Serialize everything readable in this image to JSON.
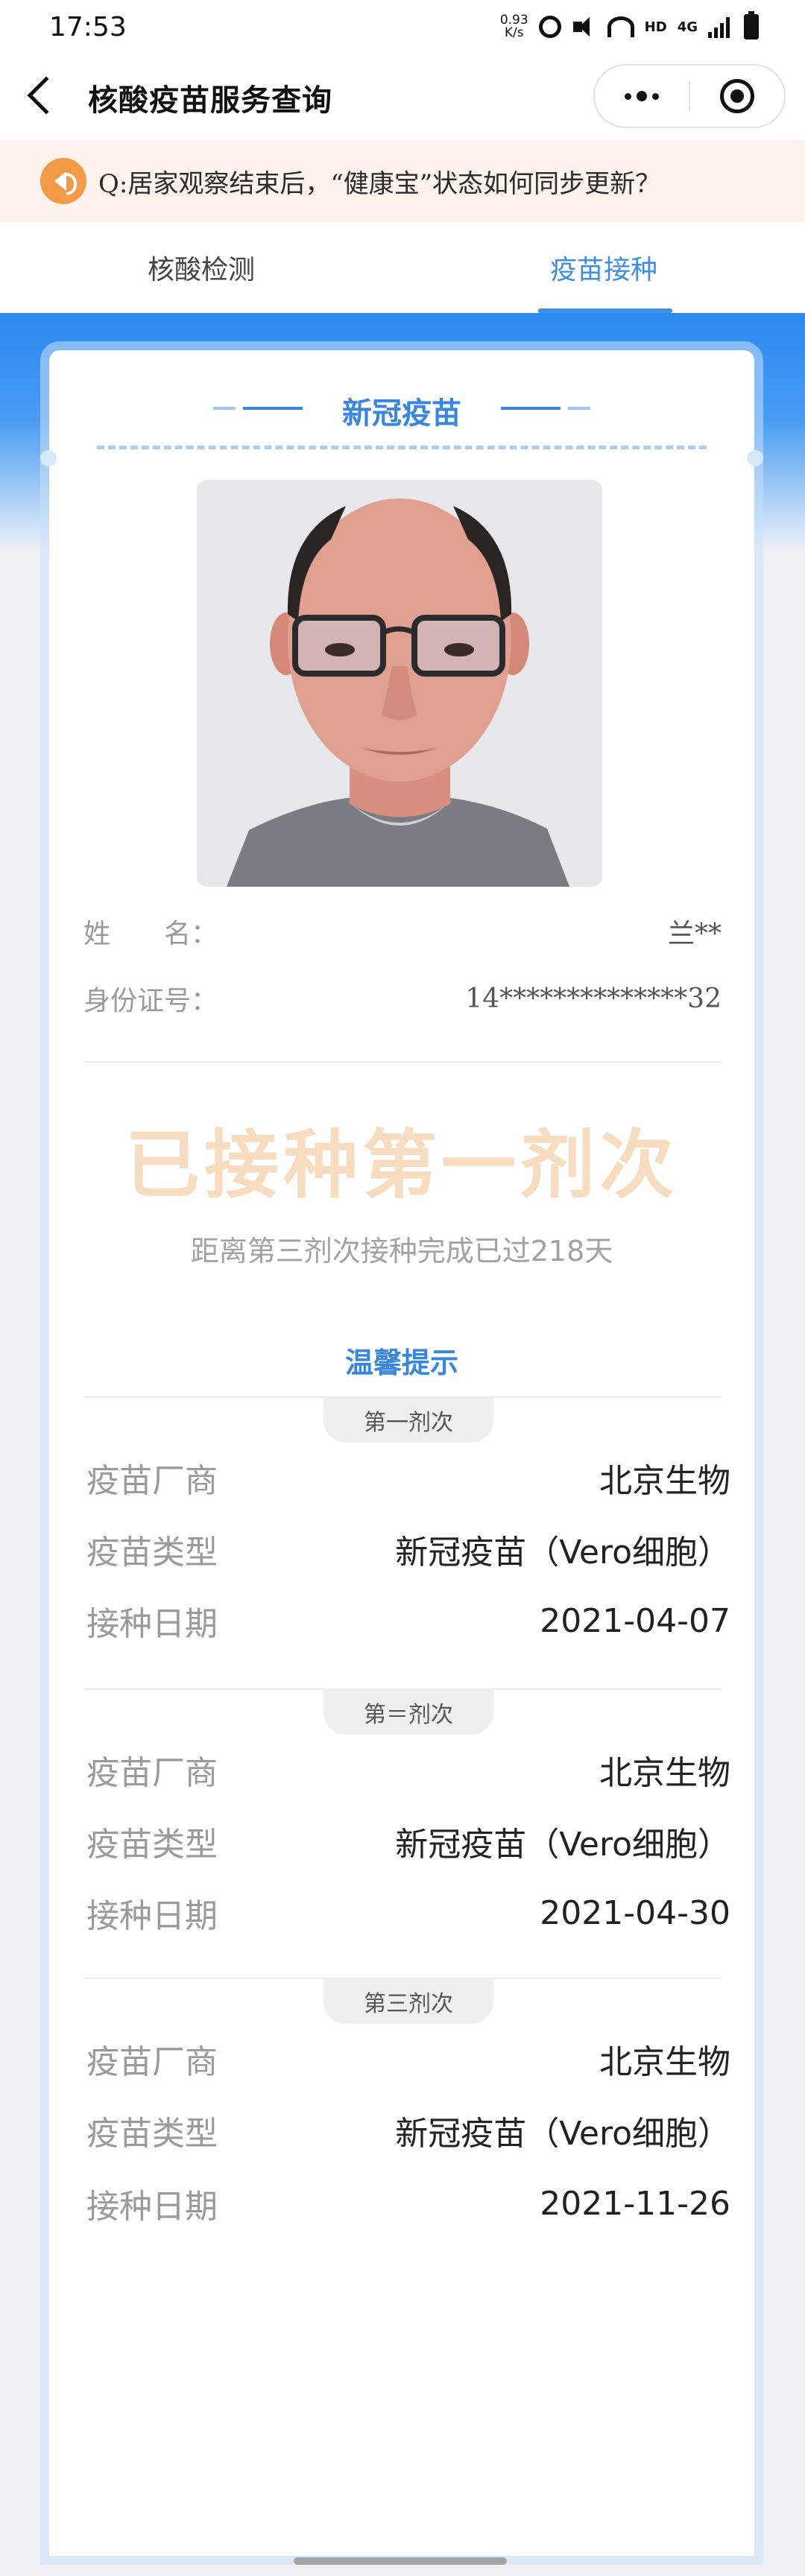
{
  "status_bar": {
    "time": "17:53",
    "net_speed_value": "0.93",
    "net_speed_unit": "K/s",
    "hd_label": "HD",
    "network_label": "4G",
    "icons": [
      "alarm-icon",
      "mute-icon",
      "wifi-icon",
      "signal-icon",
      "battery-icon"
    ]
  },
  "nav": {
    "title": "核酸疫苗服务查询",
    "back_icon": "back-arrow-icon",
    "more_icon": "more-dots-icon",
    "target_icon": "target-icon"
  },
  "notice": {
    "icon": "speaker-icon",
    "text": "Q:居家观察结束后，“健康宝”状态如何同步更新？"
  },
  "tabs": [
    {
      "label": "核酸检测",
      "active": false
    },
    {
      "label": "疫苗接种",
      "active": true
    }
  ],
  "card": {
    "title": "新冠疫苗",
    "name_label": "姓　　名：",
    "name_value": "兰**",
    "id_label": "身份证号：",
    "id_value": "14**************32",
    "status": "已接种第一剂次",
    "days_text": "距离第三剂次接种完成已过218天",
    "tips_title": "温馨提示"
  },
  "doses": [
    {
      "badge": "第一剂次",
      "rows": [
        {
          "label": "疫苗厂商",
          "value": "北京生物"
        },
        {
          "label": "疫苗类型",
          "value": "新冠疫苗（Vero细胞）"
        },
        {
          "label": "接种日期",
          "value": "2021-04-07"
        }
      ]
    },
    {
      "badge": "第＝剂次",
      "rows": [
        {
          "label": "疫苗厂商",
          "value": "北京生物"
        },
        {
          "label": "疫苗类型",
          "value": "新冠疫苗（Vero细胞）"
        },
        {
          "label": "接种日期",
          "value": "2021-04-30"
        }
      ]
    },
    {
      "badge": "第三剂次",
      "rows": [
        {
          "label": "疫苗厂商",
          "value": "北京生物"
        },
        {
          "label": "疫苗类型",
          "value": "新冠疫苗（Vero细胞）"
        },
        {
          "label": "接种日期",
          "value": "2021-11-26"
        }
      ]
    }
  ],
  "colors": {
    "accent_blue": "#3a86dc",
    "status_peach": "#f8dcc0",
    "notice_bg": "#fdf3ec",
    "speaker_orange": "#f29a46"
  }
}
